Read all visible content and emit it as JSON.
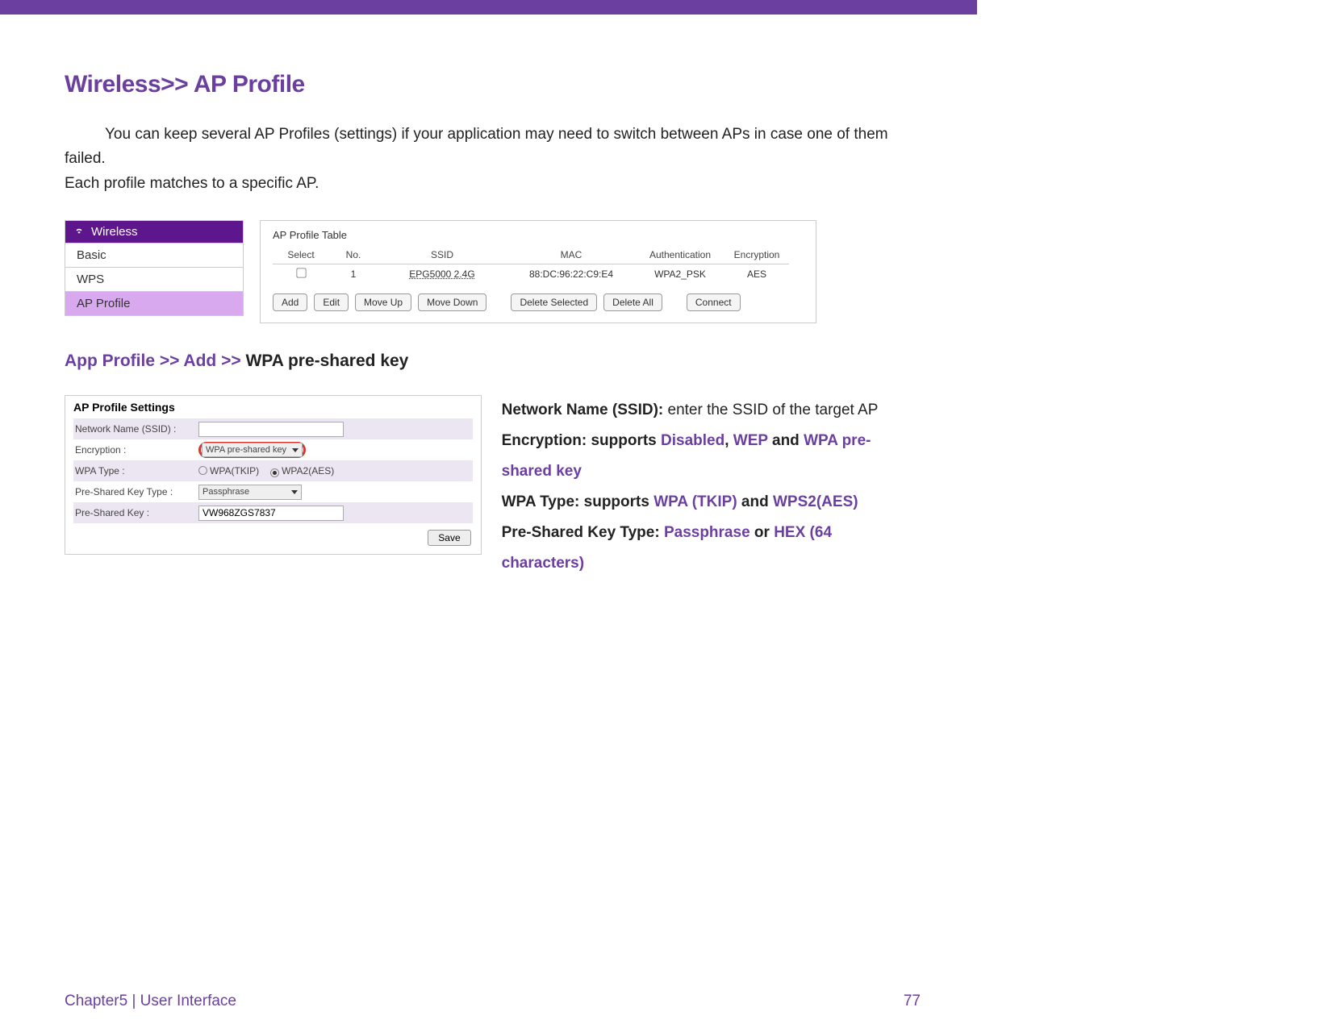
{
  "heading": "Wireless>> AP Profile",
  "intro_line1": "You can keep several AP Profiles (settings) if your application may need to switch between APs in case one of them failed.",
  "intro_line2": "Each profile matches to a specific AP.",
  "nav": {
    "title": "Wireless",
    "items": [
      "Basic",
      "WPS",
      "AP Profile"
    ],
    "selected_index": 2
  },
  "table": {
    "title": "AP Profile Table",
    "headers": [
      "Select",
      "No.",
      "SSID",
      "MAC",
      "Authentication",
      "Encryption"
    ],
    "row": {
      "no": "1",
      "ssid": "EPG5000 2.4G",
      "mac": "88:DC:96:22:C9:E4",
      "auth": "WPA2_PSK",
      "enc": "AES"
    },
    "buttons": [
      "Add",
      "Edit",
      "Move Up",
      "Move Down",
      "Delete Selected",
      "Delete All",
      "Connect"
    ]
  },
  "breadcrumb": {
    "a": "App Profile >> ",
    "b": "Add >> ",
    "c": "WPA pre-shared key"
  },
  "form": {
    "title": "AP Profile Settings",
    "labels": {
      "ssid": "Network Name (SSID) :",
      "encryption": "Encryption :",
      "wpa_type": "WPA Type :",
      "psk_type": "Pre-Shared Key Type :",
      "psk": "Pre-Shared Key :"
    },
    "encryption_value": "WPA pre-shared key",
    "wpa_type_options": [
      "WPA(TKIP)",
      "WPA2(AES)"
    ],
    "wpa_type_selected": 1,
    "psk_type_value": "Passphrase",
    "psk_value": "VW968ZGS7837",
    "save": "Save"
  },
  "desc": {
    "l1a": "Network Name (SSID): ",
    "l1b": "enter the SSID of the target AP",
    "l2a": "Encryption: supports ",
    "l2_disabled": "Disabled",
    "l2_sep1": ", ",
    "l2_wep": "WEP",
    "l2_sep2": " and ",
    "l2_wpa": "WPA pre-shared key",
    "l3a": "WPA Type: supports ",
    "l3_tkip": "WPA (TKIP)",
    "l3_sep": " and ",
    "l3_aes": "WPS2(AES)",
    "l4a": "Pre-Shared Key Type: ",
    "l4_pass": "Passphrase",
    "l4_sep": " or ",
    "l4_hex": "HEX (64 characters)"
  },
  "footer": {
    "left": "Chapter5  |  User Interface",
    "right": "77"
  }
}
